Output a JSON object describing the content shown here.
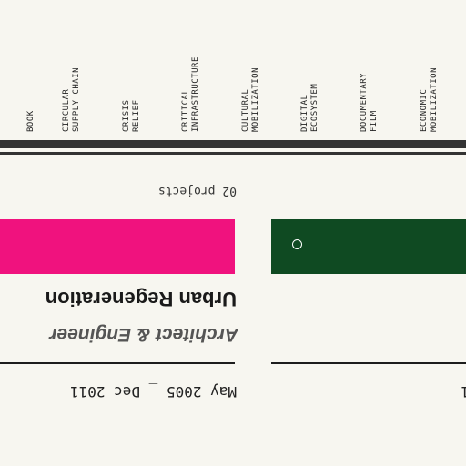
{
  "categories": [
    {
      "label": "BOOK"
    },
    {
      "label": "CIRCULAR\nSUPPLY CHAIN"
    },
    {
      "label": "CRISIS\nRELIEF"
    },
    {
      "label": "CRITICAL\nINFRASTRUCTURE"
    },
    {
      "label": "CULTURAL\nMOBILIZATION"
    },
    {
      "label": "DIGITAL\nECOSYSTEM"
    },
    {
      "label": "DOCUMENTARY\nFILM"
    },
    {
      "label": "ECONOMIC\nMOBILIZATION"
    }
  ],
  "timeline": {
    "project_count": "02 projects",
    "card": {
      "title": "Urban Regeneration",
      "role": "Architect & Engineer",
      "dates": "May 2005 _ Dec 2011",
      "color": "#f0127e"
    },
    "next_card": {
      "color": "#0f4a22",
      "date_fragment": "1"
    }
  }
}
